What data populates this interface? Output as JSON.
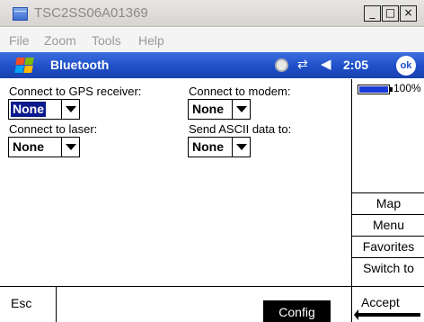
{
  "window": {
    "title": "TSC2SS06A01369",
    "minimize_label": "_",
    "maximize_label": "□",
    "close_label": "×"
  },
  "menu": {
    "items": [
      "File",
      "Zoom",
      "Tools",
      "Help"
    ]
  },
  "nav": {
    "title": "Bluetooth",
    "time": "2:05",
    "ok_label": "ok",
    "status_icons": [
      "sync-icon",
      "connectivity-icon",
      "speaker-icon"
    ]
  },
  "form": {
    "gps": {
      "label": "Connect to GPS receiver:",
      "value": "None"
    },
    "modem": {
      "label": "Connect to modem:",
      "value": "None"
    },
    "laser": {
      "label": "Connect to laser:",
      "value": "None"
    },
    "ascii": {
      "label": "Send ASCII data to:",
      "value": "None"
    }
  },
  "side_panel": {
    "battery_label": "100%",
    "battery_level": 1.0,
    "buttons": [
      "Map",
      "Menu",
      "Favorites",
      "Switch to"
    ]
  },
  "bottom": {
    "esc_label": "Esc",
    "config_label": "Config",
    "accept_label": "Accept"
  },
  "colors": {
    "nav_bar": "#1f4fc7",
    "selected_value_bg": "#0a1a8c",
    "battery_fill": "#1a3ad8"
  }
}
